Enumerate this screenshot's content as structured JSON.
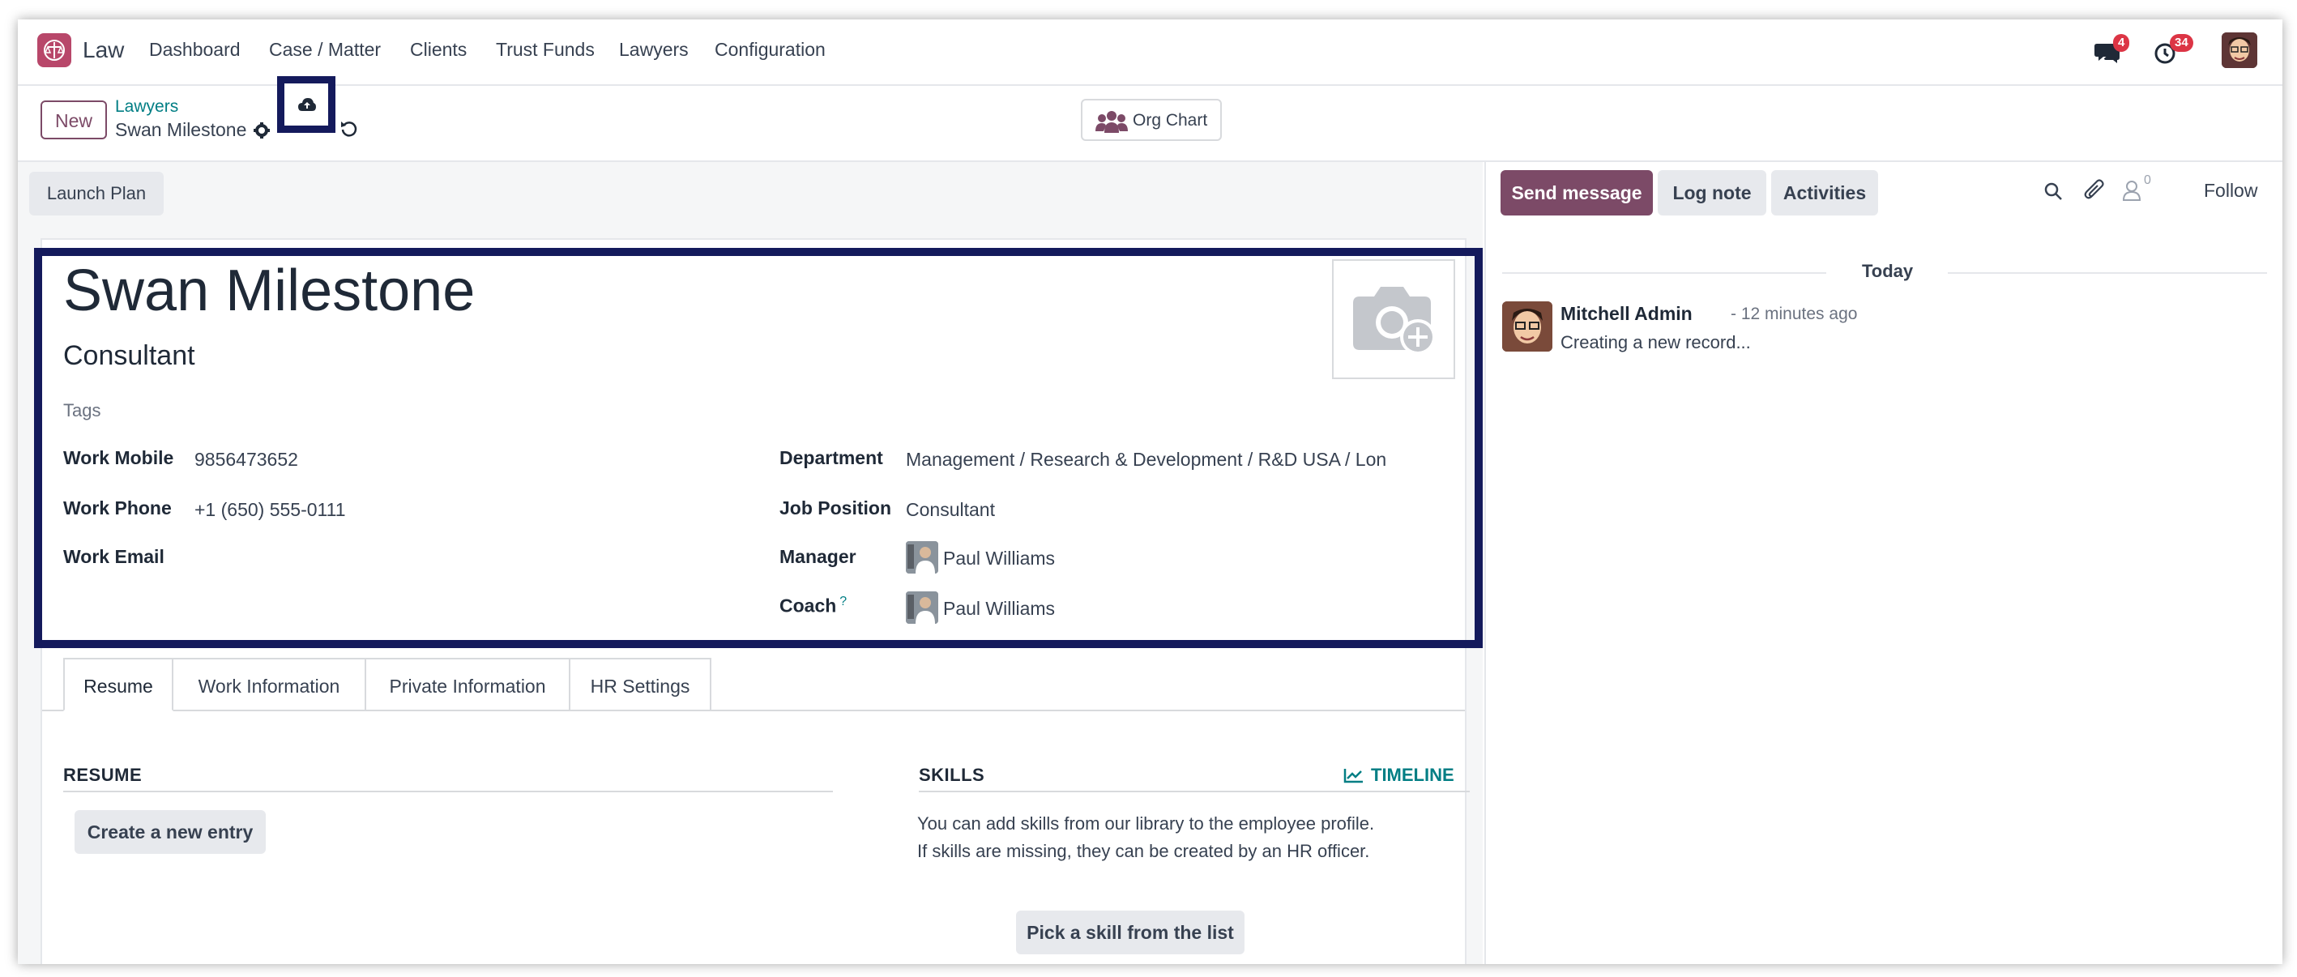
{
  "nav": {
    "app_name": "Law",
    "menu": [
      "Dashboard",
      "Case / Matter",
      "Clients",
      "Trust Funds",
      "Lawyers",
      "Configuration"
    ],
    "messages_badge": "4",
    "activities_badge": "34"
  },
  "control": {
    "new_label": "New",
    "breadcrumb_parent": "Lawyers",
    "breadcrumb_current": "Swan Milestone",
    "org_chart_label": "Org Chart"
  },
  "form": {
    "launch_plan_label": "Launch Plan",
    "name": "Swan Milestone",
    "job_title": "Consultant",
    "tags_placeholder": "Tags",
    "fields_left": [
      {
        "label": "Work Mobile",
        "value": "9856473652"
      },
      {
        "label": "Work Phone",
        "value": "+1 (650) 555-0111"
      },
      {
        "label": "Work Email",
        "value": ""
      }
    ],
    "fields_right": [
      {
        "label": "Department",
        "value": "Management / Research & Development / R&D USA / Lon"
      },
      {
        "label": "Job Position",
        "value": "Consultant"
      },
      {
        "label": "Manager",
        "value": "Paul Williams"
      },
      {
        "label": "Coach",
        "value": "Paul Williams",
        "help": "?"
      }
    ],
    "tabs": [
      "Resume",
      "Work Information",
      "Private Information",
      "HR Settings"
    ],
    "resume_title": "RESUME",
    "create_entry_label": "Create a new entry",
    "skills_title": "SKILLS",
    "timeline_label": "TIMELINE",
    "skills_text_1": "You can add skills from our library to the employee profile.",
    "skills_text_2": "If skills are missing, they can be created by an HR officer.",
    "pick_skill_label": "Pick a skill from the list"
  },
  "chatter": {
    "send_message": "Send message",
    "log_note": "Log note",
    "activities": "Activities",
    "followers_count": "0",
    "follow": "Follow",
    "today": "Today",
    "message": {
      "author": "Mitchell Admin",
      "time": "- 12 minutes ago",
      "body": "Creating a new record..."
    }
  },
  "colors": {
    "primary": "#7c4a67",
    "link": "#017e84",
    "highlight_box": "#141a5c",
    "badge": "#dc3545"
  }
}
